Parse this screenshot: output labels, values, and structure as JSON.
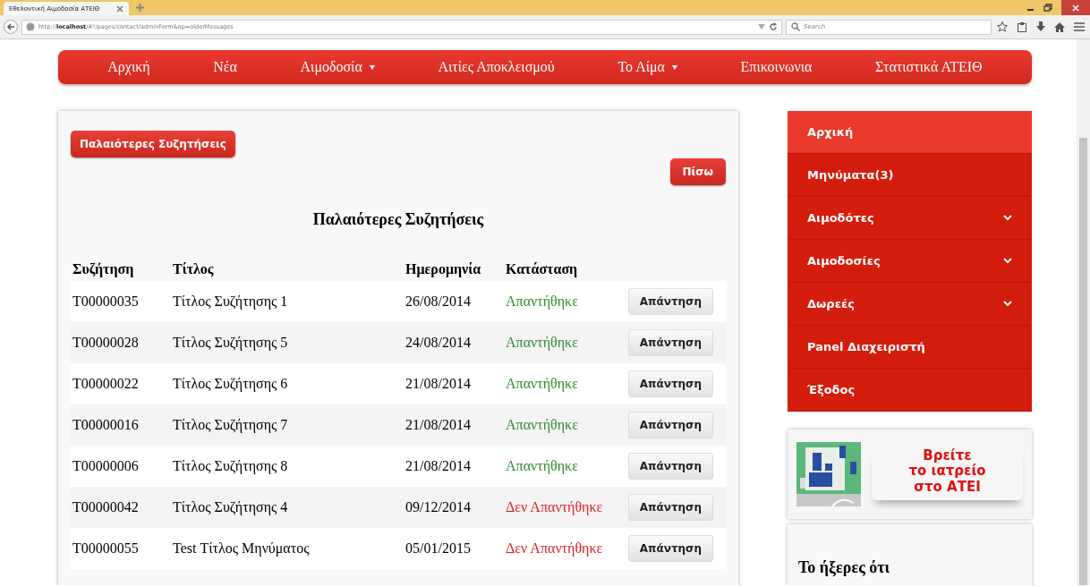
{
  "browser": {
    "tab_title": "Εθελοντική Αιμοδοσία ΑΤΕΙΘ",
    "url_prefix": "http://",
    "url_host": "localhost",
    "url_path": "/#!/pages/contact/adminForm&op=olderMessages",
    "search_placeholder": "Search"
  },
  "nav": [
    {
      "label": "Αρχική",
      "dropdown": false
    },
    {
      "label": "Νέα",
      "dropdown": false
    },
    {
      "label": "Αιμοδοσία",
      "dropdown": true
    },
    {
      "label": "Αιτίες Αποκλεισμού",
      "dropdown": false
    },
    {
      "label": "Το Αίμα",
      "dropdown": true
    },
    {
      "label": "Επικοινωνια",
      "dropdown": false
    },
    {
      "label": "Στατιστικά ΑΤΕΙΘ",
      "dropdown": false
    }
  ],
  "main": {
    "older_button": "Παλαιότερες Συζητήσεις",
    "back_button": "Πίσω",
    "heading": "Παλαιότερες Συζητήσεις",
    "columns": [
      "Συζήτηση",
      "Τίτλος",
      "Ημερομηνία",
      "Κατάσταση"
    ],
    "rows": [
      {
        "id": "T00000035",
        "title": "Τίτλος Συζήτησης 1",
        "date": "26/08/2014",
        "status": "Απαντήθηκε",
        "answered": true,
        "action": "Απάντηση"
      },
      {
        "id": "T00000028",
        "title": "Τίτλος Συζήτησης 5",
        "date": "24/08/2014",
        "status": "Απαντήθηκε",
        "answered": true,
        "action": "Απάντηση"
      },
      {
        "id": "T00000022",
        "title": "Τίτλος Συζήτησης 6",
        "date": "21/08/2014",
        "status": "Απαντήθηκε",
        "answered": true,
        "action": "Απάντηση"
      },
      {
        "id": "T00000016",
        "title": "Τίτλος Συζήτησης 7",
        "date": "21/08/2014",
        "status": "Απαντήθηκε",
        "answered": true,
        "action": "Απάντηση"
      },
      {
        "id": "T00000006",
        "title": "Τίτλος Συζήτησης 8",
        "date": "21/08/2014",
        "status": "Απαντήθηκε",
        "answered": true,
        "action": "Απάντηση"
      },
      {
        "id": "T00000042",
        "title": "Τίτλος Συζήτησης 4",
        "date": "09/12/2014",
        "status": "Δεν Απαντήθηκε",
        "answered": false,
        "action": "Απάντηση"
      },
      {
        "id": "T00000055",
        "title": "Test Τίτλος Μηνύματος",
        "date": "05/01/2015",
        "status": "Δεν Απαντήθηκε",
        "answered": false,
        "action": "Απάντηση"
      }
    ]
  },
  "sidebar": {
    "items": [
      {
        "label": "Αρχική",
        "selected": true,
        "expandable": false
      },
      {
        "label": "Μηνύματα(3)",
        "selected": false,
        "expandable": false
      },
      {
        "label": "Αιμοδότες",
        "selected": false,
        "expandable": true
      },
      {
        "label": "Αιμοδοσίες",
        "selected": false,
        "expandable": true
      },
      {
        "label": "Δωρεές",
        "selected": false,
        "expandable": true
      },
      {
        "label": "Panel Διαχειριστή",
        "selected": false,
        "expandable": false
      },
      {
        "label": "Έξοδος",
        "selected": false,
        "expandable": false
      }
    ],
    "map_banner": {
      "lines": [
        "Βρείτε",
        "το ιατρείο",
        "στο ΑΤΕΙ"
      ]
    },
    "did_you_know": "Το ήξερες ότι"
  }
}
